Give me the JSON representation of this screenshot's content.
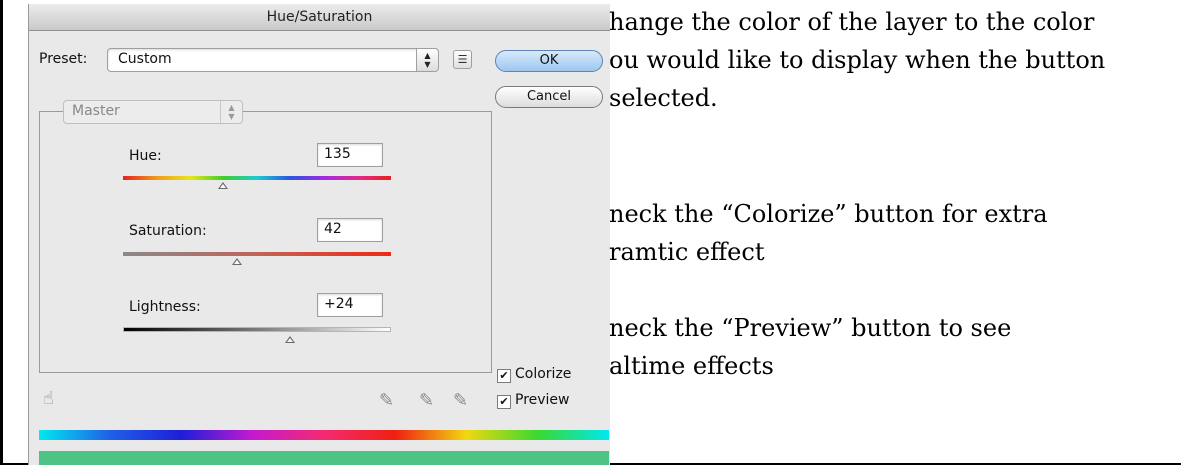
{
  "dialog": {
    "title": "Hue/Saturation",
    "preset_label": "Preset:",
    "preset_value": "Custom",
    "ok_label": "OK",
    "cancel_label": "Cancel",
    "channel_value": "Master",
    "hue_label": "Hue:",
    "hue_value": "135",
    "saturation_label": "Saturation:",
    "saturation_value": "42",
    "lightness_label": "Lightness:",
    "lightness_value": "+24",
    "colorize_label": "Colorize",
    "preview_label": "Preview",
    "colorize_checked": true,
    "preview_checked": true,
    "colorize_bar_color": "#4dc386"
  },
  "document": {
    "lines": [
      "hange the color of the layer to the color",
      "ou would like to display when the button",
      "selected.",
      "neck the “Colorize” button for extra",
      "ramtic effect",
      "neck the “Preview” button to see",
      "altime effects"
    ]
  }
}
